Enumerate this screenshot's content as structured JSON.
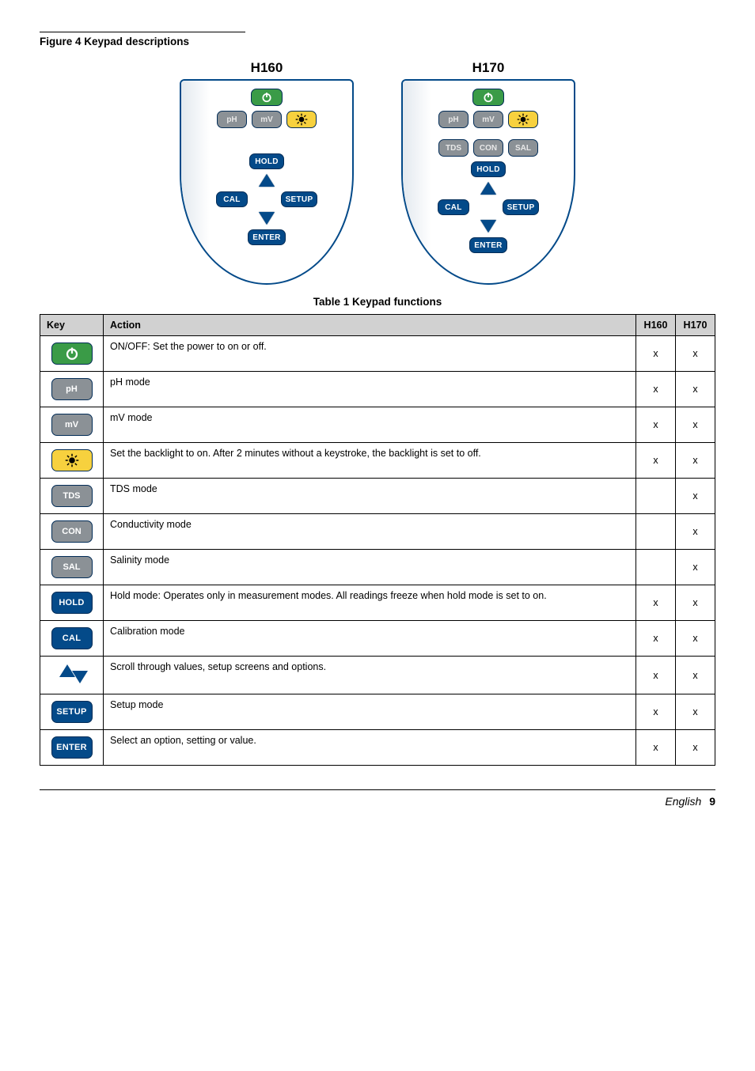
{
  "figure": {
    "label": "Figure 4  Keypad descriptions"
  },
  "keypads": {
    "left": {
      "title": "H160",
      "labels": {
        "ph": "pH",
        "mv": "mV",
        "hold": "HOLD",
        "cal": "CAL",
        "setup": "SETUP",
        "enter": "ENTER"
      }
    },
    "right": {
      "title": "H170",
      "labels": {
        "ph": "pH",
        "mv": "mV",
        "tds": "TDS",
        "con": "CON",
        "sal": "SAL",
        "hold": "HOLD",
        "cal": "CAL",
        "setup": "SETUP",
        "enter": "ENTER"
      }
    }
  },
  "table": {
    "caption": "Table 1  Keypad functions",
    "headers": {
      "key": "Key",
      "action": "Action",
      "h160": "H160",
      "h170": "H170"
    },
    "rows": [
      {
        "key_label": "",
        "key_type": "power",
        "action": "ON/OFF: Set the power to on or off.",
        "h160": "x",
        "h170": "x"
      },
      {
        "key_label": "pH",
        "key_type": "gray",
        "action": "pH mode",
        "h160": "x",
        "h170": "x"
      },
      {
        "key_label": "mV",
        "key_type": "gray",
        "action": "mV mode",
        "h160": "x",
        "h170": "x"
      },
      {
        "key_label": "",
        "key_type": "backlight",
        "action": "Set the backlight to on. After 2 minutes without a keystroke, the backlight is set to off.",
        "h160": "x",
        "h170": "x"
      },
      {
        "key_label": "TDS",
        "key_type": "gray",
        "action": "TDS mode",
        "h160": "",
        "h170": "x"
      },
      {
        "key_label": "CON",
        "key_type": "gray",
        "action": "Conductivity mode",
        "h160": "",
        "h170": "x"
      },
      {
        "key_label": "SAL",
        "key_type": "gray",
        "action": "Salinity mode",
        "h160": "",
        "h170": "x"
      },
      {
        "key_label": "HOLD",
        "key_type": "blue",
        "action": "Hold mode: Operates only in measurement modes. All readings freeze when hold mode is set to on.",
        "h160": "x",
        "h170": "x"
      },
      {
        "key_label": "CAL",
        "key_type": "blue",
        "action": "Calibration mode",
        "h160": "x",
        "h170": "x"
      },
      {
        "key_label": "",
        "key_type": "arrows",
        "action": "Scroll through values, setup screens and options.",
        "h160": "x",
        "h170": "x"
      },
      {
        "key_label": "SETUP",
        "key_type": "blue",
        "action": "Setup mode",
        "h160": "x",
        "h170": "x"
      },
      {
        "key_label": "ENTER",
        "key_type": "blue",
        "action": "Select an option, setting or value.",
        "h160": "x",
        "h170": "x"
      }
    ]
  },
  "footer": {
    "lang": "English",
    "page": "9"
  }
}
